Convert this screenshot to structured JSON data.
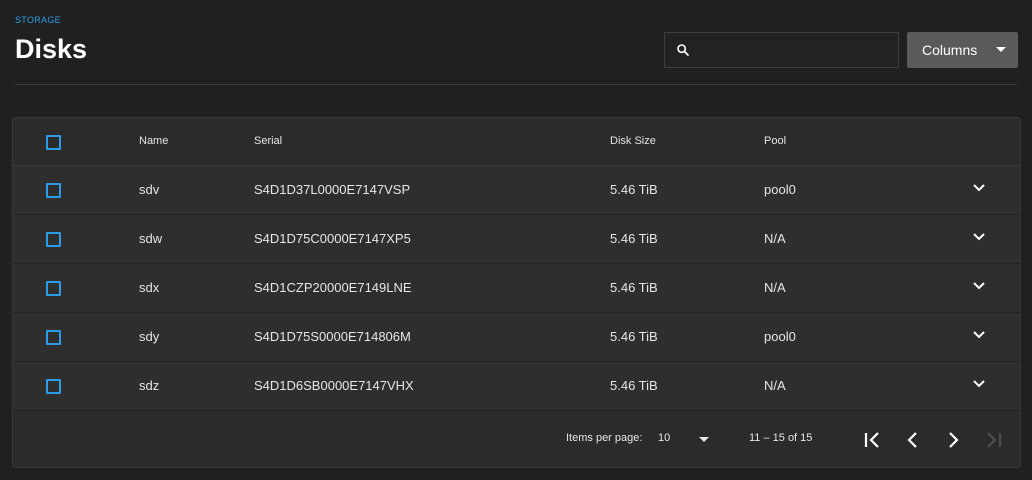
{
  "breadcrumb": "STORAGE",
  "page_title": "Disks",
  "search": {
    "placeholder": "",
    "value": ""
  },
  "columns_button": "Columns",
  "table": {
    "headers": {
      "name": "Name",
      "serial": "Serial",
      "disk_size": "Disk Size",
      "pool": "Pool"
    },
    "rows": [
      {
        "name": "sdv",
        "serial": "S4D1D37L0000E7147VSP",
        "disk_size": "5.46 TiB",
        "pool": "pool0"
      },
      {
        "name": "sdw",
        "serial": "S4D1D75C0000E7147XP5",
        "disk_size": "5.46 TiB",
        "pool": "N/A"
      },
      {
        "name": "sdx",
        "serial": "S4D1CZP20000E7149LNE",
        "disk_size": "5.46 TiB",
        "pool": "N/A"
      },
      {
        "name": "sdy",
        "serial": "S4D1D75S0000E714806M",
        "disk_size": "5.46 TiB",
        "pool": "pool0"
      },
      {
        "name": "sdz",
        "serial": "S4D1D6SB0000E7147VHX",
        "disk_size": "5.46 TiB",
        "pool": "N/A"
      }
    ]
  },
  "paginator": {
    "items_per_page_label": "Items per page:",
    "items_per_page": "10",
    "range": "11 – 15 of 15"
  },
  "icons": {
    "search": "search-icon",
    "expand": "chevron-down-icon",
    "first": "first-page-icon",
    "prev": "chevron-left-icon",
    "next": "chevron-right-icon",
    "last": "last-page-icon"
  },
  "colors": {
    "accent": "#2b9ce6",
    "background": "#202020",
    "card": "#2b2b2b",
    "button": "#5a5a5a"
  }
}
